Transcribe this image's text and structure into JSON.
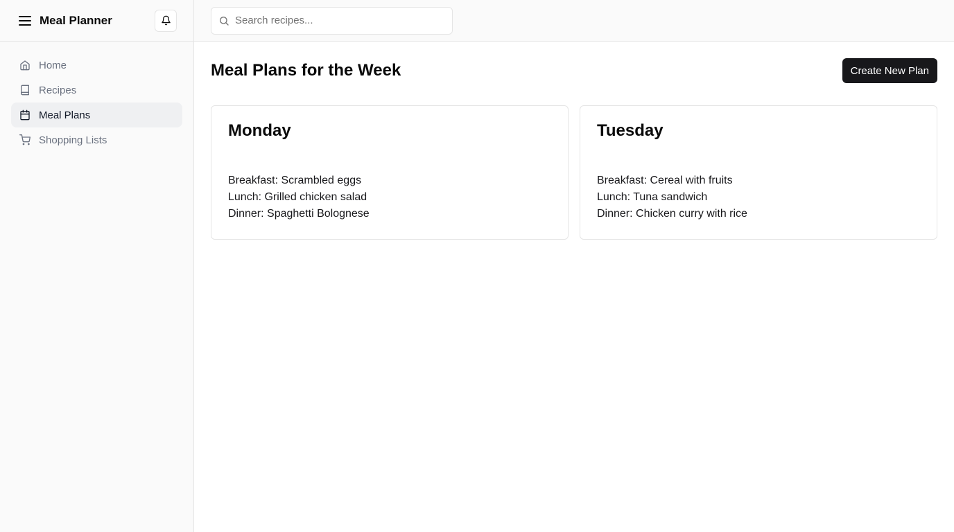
{
  "app": {
    "title": "Meal Planner"
  },
  "sidebar": {
    "items": [
      {
        "label": "Home",
        "icon": "home-icon",
        "active": false
      },
      {
        "label": "Recipes",
        "icon": "book-icon",
        "active": false
      },
      {
        "label": "Meal Plans",
        "icon": "calendar-icon",
        "active": true
      },
      {
        "label": "Shopping Lists",
        "icon": "cart-icon",
        "active": false
      }
    ]
  },
  "search": {
    "placeholder": "Search recipes..."
  },
  "main": {
    "title": "Meal Plans for the Week",
    "create_button": "Create New Plan",
    "days": [
      {
        "name": "Monday",
        "meals": [
          "Breakfast: Scrambled eggs",
          "Lunch: Grilled chicken salad",
          "Dinner: Spaghetti Bolognese"
        ]
      },
      {
        "name": "Tuesday",
        "meals": [
          "Breakfast: Cereal with fruits",
          "Lunch: Tuna sandwich",
          "Dinner: Chicken curry with rice"
        ]
      }
    ]
  },
  "colors": {
    "sidebar_bg": "#fafafa",
    "active_item_bg": "#eff0f2",
    "primary_button": "#18181b",
    "border": "#e5e5e5"
  }
}
